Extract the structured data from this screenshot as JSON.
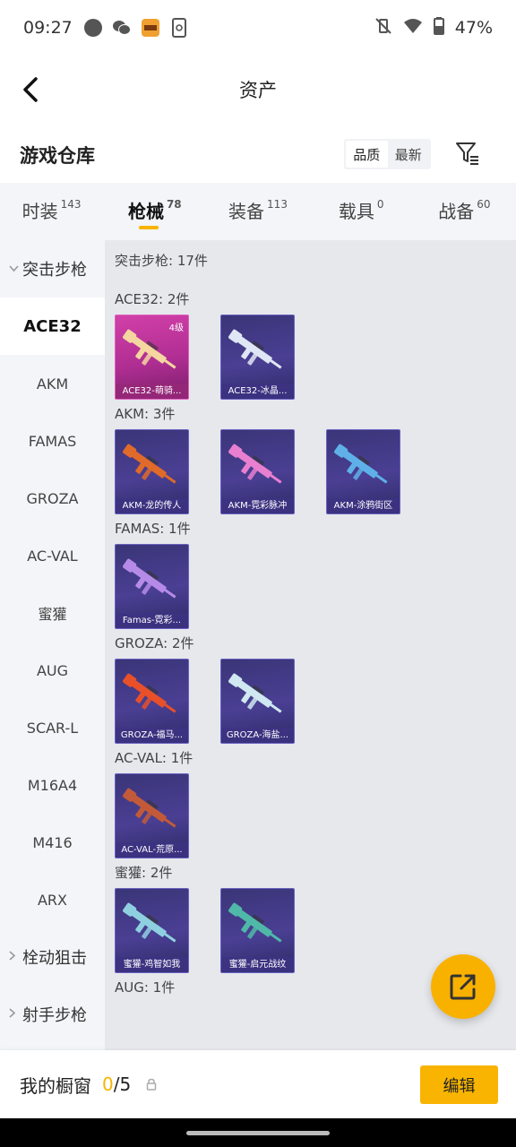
{
  "status_bar": {
    "time": "09:27",
    "battery": "47%"
  },
  "header": {
    "title": "资产"
  },
  "warehouse": {
    "title": "游戏仓库",
    "sort_options": [
      "品质",
      "最新"
    ],
    "active_sort": "品质"
  },
  "tabs": [
    {
      "label": "时装",
      "count": "143",
      "active": false
    },
    {
      "label": "枪械",
      "count": "78",
      "active": true
    },
    {
      "label": "装备",
      "count": "113",
      "active": false
    },
    {
      "label": "载具",
      "count": "0",
      "active": false
    },
    {
      "label": "战备",
      "count": "60",
      "active": false
    }
  ],
  "sidebar": {
    "category": "突击步枪",
    "items": [
      "ACE32",
      "AKM",
      "FAMAS",
      "GROZA",
      "AC-VAL",
      "蜜獾",
      "AUG",
      "SCAR-L",
      "M16A4",
      "M416",
      "ARX"
    ],
    "active": "ACE32",
    "more_categories": [
      "栓动狙击",
      "射手步枪"
    ]
  },
  "main": {
    "section_title": "突击步枪: 17件",
    "groups": [
      {
        "label": "ACE32: 2件",
        "items": [
          {
            "name": "ACE32-萌骑...",
            "level": "4级",
            "style": "pink",
            "gun_color": "#f5d6a0"
          },
          {
            "name": "ACE32-冰晶...",
            "level": "",
            "style": "purple",
            "gun_color": "#dfe6f5"
          }
        ]
      },
      {
        "label": "AKM: 3件",
        "items": [
          {
            "name": "AKM-龙的传人",
            "level": "",
            "style": "purple",
            "gun_color": "#e06a2a"
          },
          {
            "name": "AKM-霓彩脉冲",
            "level": "",
            "style": "purple",
            "gun_color": "#e87fd0"
          },
          {
            "name": "AKM-涂鸦街区",
            "level": "",
            "style": "purple",
            "gun_color": "#5fb0e8"
          }
        ]
      },
      {
        "label": "FAMAS: 1件",
        "items": [
          {
            "name": "Famas-霓彩...",
            "level": "",
            "style": "purple",
            "gun_color": "#b68be8"
          }
        ]
      },
      {
        "label": "GROZA: 2件",
        "items": [
          {
            "name": "GROZA-福马...",
            "level": "",
            "style": "purple",
            "gun_color": "#e8502a"
          },
          {
            "name": "GROZA-海盐...",
            "level": "",
            "style": "purple",
            "gun_color": "#cfe8f2"
          }
        ]
      },
      {
        "label": "AC-VAL: 1件",
        "items": [
          {
            "name": "AC-VAL-荒原...",
            "level": "",
            "style": "purple",
            "gun_color": "#c25a3a"
          }
        ]
      },
      {
        "label": "蜜獾: 2件",
        "items": [
          {
            "name": "蜜獾-鸡智如我",
            "level": "",
            "style": "purple",
            "gun_color": "#8fd0e0"
          },
          {
            "name": "蜜獾-启元战纹",
            "level": "",
            "style": "purple",
            "gun_color": "#4fb8a8"
          }
        ]
      },
      {
        "label": "AUG: 1件",
        "items": []
      }
    ]
  },
  "showcase": {
    "label": "我的橱窗",
    "current": "0",
    "total": "5",
    "edit_label": "编辑"
  },
  "colors": {
    "accent": "#f8b400"
  }
}
